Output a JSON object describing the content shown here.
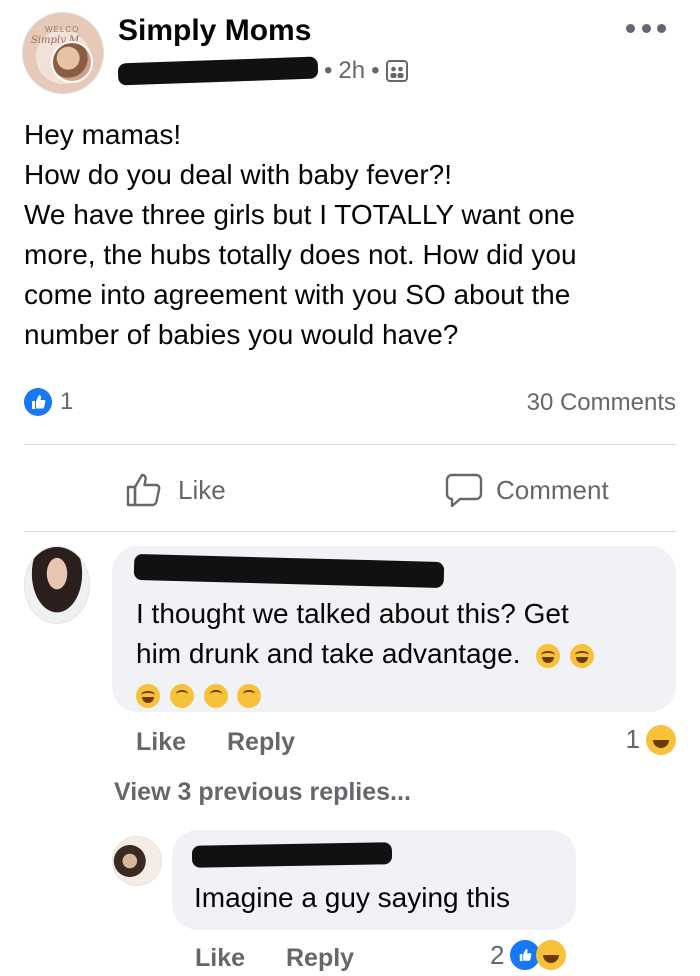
{
  "post": {
    "page_name": "Simply Moms",
    "time": "2h",
    "separator": "•",
    "avatar_text_top": "WELCO",
    "avatar_text_script": "Simply M",
    "body_lines": [
      "Hey mamas!",
      "How do you deal with baby fever?!",
      "We have three girls but I TOTALLY want one",
      "more, the hubs totally does not. How did you",
      "come into agreement with you SO about the",
      "number of babies you would have?"
    ],
    "like_count": "1",
    "comments_count": "30 Comments"
  },
  "actions": {
    "like_label": "Like",
    "comment_label": "Comment"
  },
  "comment1": {
    "text_lines": [
      "I thought we talked about this? Get",
      "him drunk and take advantage."
    ],
    "like_label": "Like",
    "reply_label": "Reply",
    "reaction_count": "1",
    "view_previous": "View 3 previous replies..."
  },
  "reply1": {
    "text": "Imagine a guy saying this",
    "like_label": "Like",
    "reply_label": "Reply",
    "reaction_count": "2"
  },
  "colors": {
    "accent": "#1877f2",
    "secondary_text": "#65676b",
    "bubble": "#f0f2f5"
  },
  "icons": [
    "more-icon",
    "group-privacy-icon",
    "like-badge-icon",
    "thumbs-up-icon",
    "comment-bubble-icon",
    "laugh-emoji-icon",
    "upside-down-emoji-icon",
    "haha-reaction-icon",
    "like-reaction-icon"
  ]
}
